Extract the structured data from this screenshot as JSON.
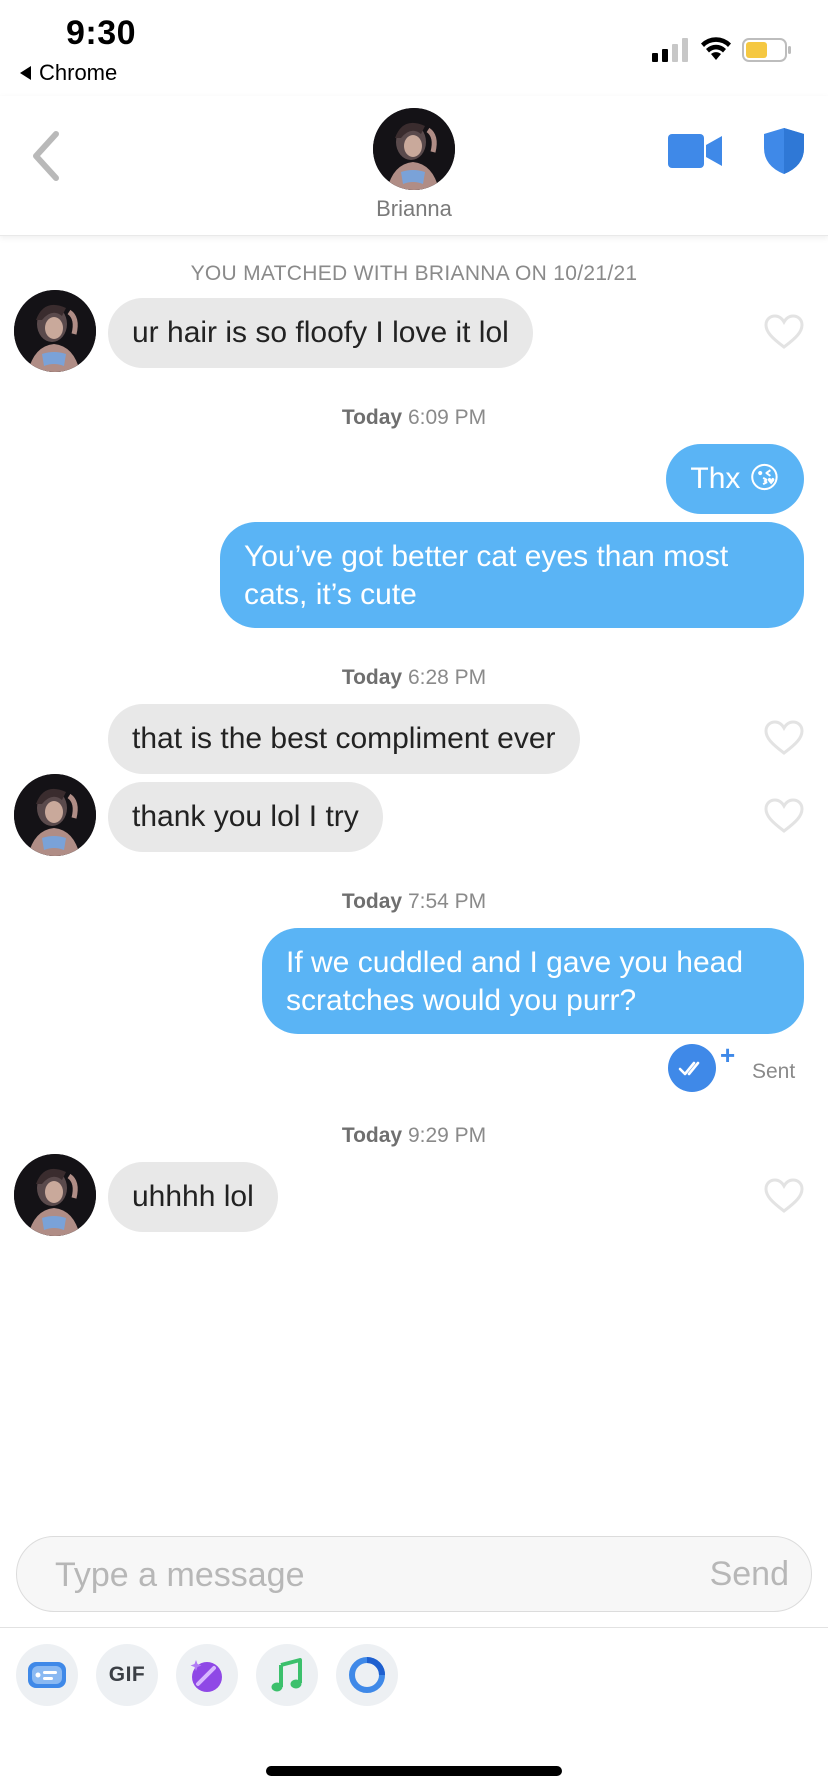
{
  "status_bar": {
    "time": "9:30",
    "back_app": "Chrome",
    "battery_color": "#f5c842"
  },
  "header": {
    "name": "Brianna",
    "accent": "#3f89e8"
  },
  "conversation": {
    "match_notice": "YOU MATCHED WITH BRIANNA ON 10/21/21",
    "groups": [
      {
        "day": "Today",
        "time": "6:09 PM"
      },
      {
        "day": "Today",
        "time": "6:28 PM"
      },
      {
        "day": "Today",
        "time": "7:54 PM"
      },
      {
        "day": "Today",
        "time": "9:29 PM"
      }
    ],
    "messages": [
      {
        "from": "them",
        "text": "ur hair is so floofy I love it lol"
      },
      {
        "from": "me",
        "text": "Thx 😘"
      },
      {
        "from": "me",
        "text": "You’ve got better cat eyes than most cats, it’s cute"
      },
      {
        "from": "them",
        "text": "that is the best compliment ever"
      },
      {
        "from": "them",
        "text": "thank you lol I try"
      },
      {
        "from": "me",
        "text": "If we cuddled and I gave you head scratches would you purr?"
      },
      {
        "from": "them",
        "text": "uhhhh lol"
      }
    ],
    "sent_status": "Sent",
    "incoming_bubble_color": "#e8e8e8",
    "outgoing_bubble_color": "#5ab4f5"
  },
  "composer": {
    "placeholder": "Type a message",
    "value": "",
    "send_label": "Send"
  },
  "toolbar": {
    "items": [
      {
        "icon": "sticker-card-icon"
      },
      {
        "icon": "gif-icon",
        "label": "GIF"
      },
      {
        "icon": "magic-sparkle-icon"
      },
      {
        "icon": "music-note-icon"
      },
      {
        "icon": "ring-icon"
      }
    ]
  }
}
